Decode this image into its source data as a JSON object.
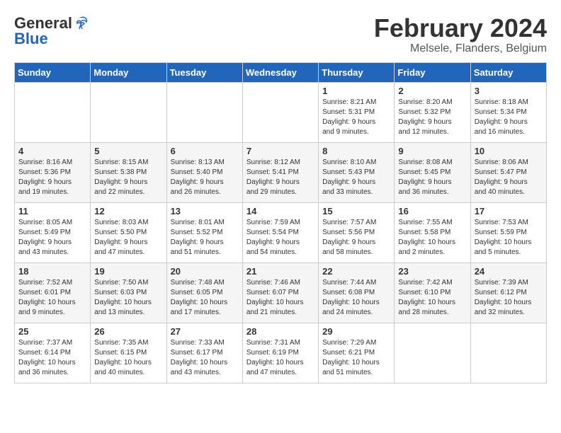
{
  "logo": {
    "text_general": "General",
    "text_blue": "Blue"
  },
  "title": {
    "month_year": "February 2024",
    "location": "Melsele, Flanders, Belgium"
  },
  "days_of_week": [
    "Sunday",
    "Monday",
    "Tuesday",
    "Wednesday",
    "Thursday",
    "Friday",
    "Saturday"
  ],
  "weeks": [
    [
      {
        "day": "",
        "info": ""
      },
      {
        "day": "",
        "info": ""
      },
      {
        "day": "",
        "info": ""
      },
      {
        "day": "",
        "info": ""
      },
      {
        "day": "1",
        "info": "Sunrise: 8:21 AM\nSunset: 5:31 PM\nDaylight: 9 hours\nand 9 minutes."
      },
      {
        "day": "2",
        "info": "Sunrise: 8:20 AM\nSunset: 5:32 PM\nDaylight: 9 hours\nand 12 minutes."
      },
      {
        "day": "3",
        "info": "Sunrise: 8:18 AM\nSunset: 5:34 PM\nDaylight: 9 hours\nand 16 minutes."
      }
    ],
    [
      {
        "day": "4",
        "info": "Sunrise: 8:16 AM\nSunset: 5:36 PM\nDaylight: 9 hours\nand 19 minutes."
      },
      {
        "day": "5",
        "info": "Sunrise: 8:15 AM\nSunset: 5:38 PM\nDaylight: 9 hours\nand 22 minutes."
      },
      {
        "day": "6",
        "info": "Sunrise: 8:13 AM\nSunset: 5:40 PM\nDaylight: 9 hours\nand 26 minutes."
      },
      {
        "day": "7",
        "info": "Sunrise: 8:12 AM\nSunset: 5:41 PM\nDaylight: 9 hours\nand 29 minutes."
      },
      {
        "day": "8",
        "info": "Sunrise: 8:10 AM\nSunset: 5:43 PM\nDaylight: 9 hours\nand 33 minutes."
      },
      {
        "day": "9",
        "info": "Sunrise: 8:08 AM\nSunset: 5:45 PM\nDaylight: 9 hours\nand 36 minutes."
      },
      {
        "day": "10",
        "info": "Sunrise: 8:06 AM\nSunset: 5:47 PM\nDaylight: 9 hours\nand 40 minutes."
      }
    ],
    [
      {
        "day": "11",
        "info": "Sunrise: 8:05 AM\nSunset: 5:49 PM\nDaylight: 9 hours\nand 43 minutes."
      },
      {
        "day": "12",
        "info": "Sunrise: 8:03 AM\nSunset: 5:50 PM\nDaylight: 9 hours\nand 47 minutes."
      },
      {
        "day": "13",
        "info": "Sunrise: 8:01 AM\nSunset: 5:52 PM\nDaylight: 9 hours\nand 51 minutes."
      },
      {
        "day": "14",
        "info": "Sunrise: 7:59 AM\nSunset: 5:54 PM\nDaylight: 9 hours\nand 54 minutes."
      },
      {
        "day": "15",
        "info": "Sunrise: 7:57 AM\nSunset: 5:56 PM\nDaylight: 9 hours\nand 58 minutes."
      },
      {
        "day": "16",
        "info": "Sunrise: 7:55 AM\nSunset: 5:58 PM\nDaylight: 10 hours\nand 2 minutes."
      },
      {
        "day": "17",
        "info": "Sunrise: 7:53 AM\nSunset: 5:59 PM\nDaylight: 10 hours\nand 5 minutes."
      }
    ],
    [
      {
        "day": "18",
        "info": "Sunrise: 7:52 AM\nSunset: 6:01 PM\nDaylight: 10 hours\nand 9 minutes."
      },
      {
        "day": "19",
        "info": "Sunrise: 7:50 AM\nSunset: 6:03 PM\nDaylight: 10 hours\nand 13 minutes."
      },
      {
        "day": "20",
        "info": "Sunrise: 7:48 AM\nSunset: 6:05 PM\nDaylight: 10 hours\nand 17 minutes."
      },
      {
        "day": "21",
        "info": "Sunrise: 7:46 AM\nSunset: 6:07 PM\nDaylight: 10 hours\nand 21 minutes."
      },
      {
        "day": "22",
        "info": "Sunrise: 7:44 AM\nSunset: 6:08 PM\nDaylight: 10 hours\nand 24 minutes."
      },
      {
        "day": "23",
        "info": "Sunrise: 7:42 AM\nSunset: 6:10 PM\nDaylight: 10 hours\nand 28 minutes."
      },
      {
        "day": "24",
        "info": "Sunrise: 7:39 AM\nSunset: 6:12 PM\nDaylight: 10 hours\nand 32 minutes."
      }
    ],
    [
      {
        "day": "25",
        "info": "Sunrise: 7:37 AM\nSunset: 6:14 PM\nDaylight: 10 hours\nand 36 minutes."
      },
      {
        "day": "26",
        "info": "Sunrise: 7:35 AM\nSunset: 6:15 PM\nDaylight: 10 hours\nand 40 minutes."
      },
      {
        "day": "27",
        "info": "Sunrise: 7:33 AM\nSunset: 6:17 PM\nDaylight: 10 hours\nand 43 minutes."
      },
      {
        "day": "28",
        "info": "Sunrise: 7:31 AM\nSunset: 6:19 PM\nDaylight: 10 hours\nand 47 minutes."
      },
      {
        "day": "29",
        "info": "Sunrise: 7:29 AM\nSunset: 6:21 PM\nDaylight: 10 hours\nand 51 minutes."
      },
      {
        "day": "",
        "info": ""
      },
      {
        "day": "",
        "info": ""
      }
    ]
  ]
}
